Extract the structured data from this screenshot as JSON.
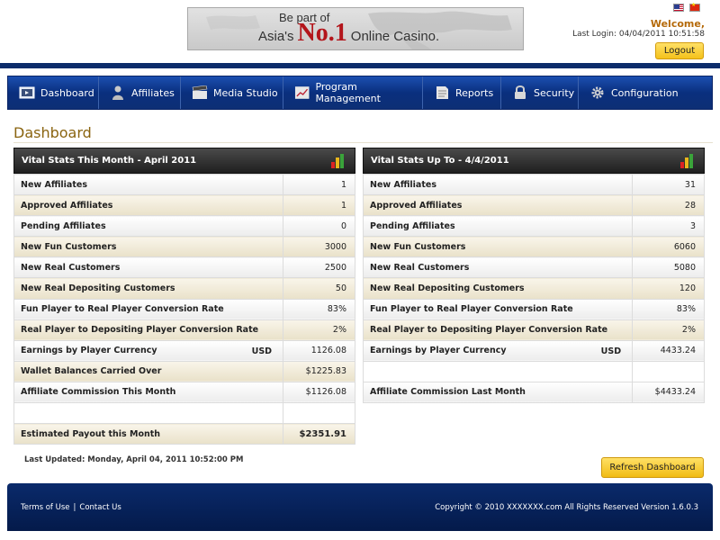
{
  "header": {
    "banner_line1": "Be part of",
    "banner_prefix": "Asia's",
    "banner_no1": "No.1",
    "banner_suffix": "Online Casino.",
    "welcome": "Welcome,",
    "last_login": "Last Login: 04/04/2011 10:51:58",
    "logout_label": "Logout"
  },
  "nav": [
    {
      "label": "Dashboard",
      "icon": "dashboard-icon"
    },
    {
      "label": "Affiliates",
      "icon": "user-icon"
    },
    {
      "label": "Media Studio",
      "icon": "clapperboard-icon"
    },
    {
      "label": "Program Management",
      "icon": "chart-icon"
    },
    {
      "label": "Reports",
      "icon": "document-icon"
    },
    {
      "label": "Security",
      "icon": "lock-icon"
    },
    {
      "label": "Configuration",
      "icon": "gear-icon"
    }
  ],
  "page_title": "Dashboard",
  "left_panel": {
    "title": "Vital Stats This Month - April 2011",
    "rows": [
      {
        "label": "New Affiliates",
        "value": "1"
      },
      {
        "label": "Approved Affiliates",
        "value": "1"
      },
      {
        "label": "Pending Affiliates",
        "value": "0"
      },
      {
        "label": "New Fun Customers",
        "value": "3000"
      },
      {
        "label": "New Real Customers",
        "value": "2500"
      },
      {
        "label": "New Real Depositing Customers",
        "value": "50"
      },
      {
        "label": "Fun Player to Real Player Conversion Rate",
        "value": "83%"
      },
      {
        "label": "Real Player to Depositing Player Conversion Rate",
        "value": "2%"
      },
      {
        "label": "Earnings by Player Currency",
        "currency": "USD",
        "value": "1126.08"
      },
      {
        "label": "Wallet Balances Carried Over",
        "value": "$1225.83"
      },
      {
        "label": "Affiliate Commission This Month",
        "value": "$1126.08"
      },
      {
        "label": "",
        "value": ""
      },
      {
        "label": "Estimated Payout this Month",
        "value": "$2351.91"
      }
    ]
  },
  "right_panel": {
    "title": "Vital Stats Up To - 4/4/2011",
    "rows": [
      {
        "label": "New Affiliates",
        "value": "31"
      },
      {
        "label": "Approved Affiliates",
        "value": "28"
      },
      {
        "label": "Pending Affiliates",
        "value": "3"
      },
      {
        "label": "New Fun Customers",
        "value": "6060"
      },
      {
        "label": "New Real Customers",
        "value": "5080"
      },
      {
        "label": "New Real Depositing Customers",
        "value": "120"
      },
      {
        "label": "Fun Player to Real Player Conversion Rate",
        "value": "83%"
      },
      {
        "label": "Real Player to Depositing Player Conversion Rate",
        "value": "2%"
      },
      {
        "label": "Earnings by Player Currency",
        "currency": "USD",
        "value": "4433.24"
      },
      {
        "label": "",
        "value": ""
      },
      {
        "label": "Affiliate Commission Last Month",
        "value": "$4433.24"
      }
    ]
  },
  "last_updated": "Last Updated: Monday, April 04, 2011 10:52:00 PM",
  "refresh_label": "Refresh Dashboard",
  "footer": {
    "terms": "Terms of Use",
    "separator": "|",
    "contact": "Contact Us",
    "copyright": "Copyright © 2010 XXXXXXX.com All Rights Reserved  Version 1.6.0.3"
  },
  "colors": {
    "nav_blue": "#0a2f7e",
    "gold_button": "#f4c21b",
    "title_gold": "#8a6410",
    "welcome_orange": "#b56a0a"
  }
}
